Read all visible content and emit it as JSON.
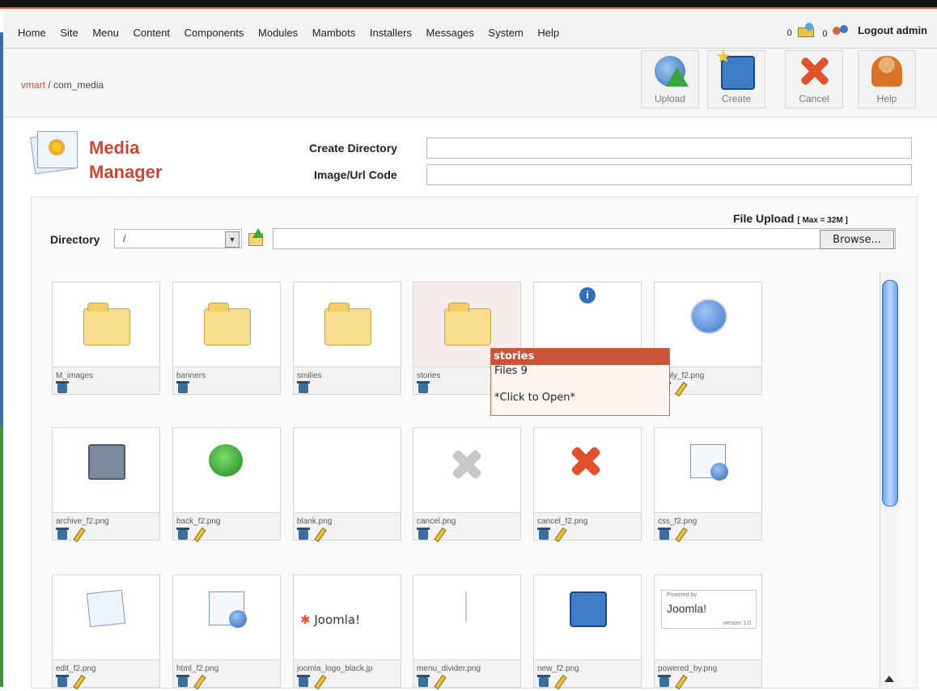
{
  "menu": {
    "items": [
      "Home",
      "Site",
      "Menu",
      "Content",
      "Components",
      "Modules",
      "Mambots",
      "Installers",
      "Messages",
      "System",
      "Help"
    ],
    "messages_count": "0",
    "users_count": "0",
    "logout_label": "Logout admin"
  },
  "breadcrumb": {
    "link": "vmart",
    "separator": " / ",
    "current": "com_media"
  },
  "toolbar": {
    "upload": "Upload",
    "create": "Create",
    "cancel": "Cancel",
    "help": "Help"
  },
  "header": {
    "title_line1": "Media",
    "title_line2": "Manager"
  },
  "form": {
    "create_directory_label": "Create Directory",
    "image_url_label": "Image/Url Code",
    "directory_label": "Directory",
    "directory_value": "/",
    "file_upload_label": "File Upload",
    "max_label": "[ Max = 32M ]",
    "browse_label": "Browse..."
  },
  "tiles": [
    {
      "name": "M_images",
      "icon": "folder-icon"
    },
    {
      "name": "banners",
      "icon": "folder-icon"
    },
    {
      "name": "smilies",
      "icon": "folder-icon"
    },
    {
      "name": "stories",
      "icon": "folder-icon"
    },
    {
      "name": "",
      "icon": "info-icon"
    },
    {
      "name": "apply_f2.png",
      "icon": "check-icon"
    },
    {
      "name": "archive_f2.png",
      "icon": "archive-icon"
    },
    {
      "name": "back_f2.png",
      "icon": "back-icon"
    },
    {
      "name": "blank.png",
      "icon": "blank"
    },
    {
      "name": "cancel.png",
      "icon": "cancel-gray-icon"
    },
    {
      "name": "cancel_f2.png",
      "icon": "cancel-red-icon"
    },
    {
      "name": "css_f2.png",
      "icon": "css-icon"
    },
    {
      "name": "edit_f2.png",
      "icon": "edit-icon"
    },
    {
      "name": "html_f2.png",
      "icon": "html-icon"
    },
    {
      "name": "joomla_logo_black.jp",
      "icon": "joomla-logo"
    },
    {
      "name": "menu_divider.png",
      "icon": "divider"
    },
    {
      "name": "new_f2.png",
      "icon": "new-icon"
    },
    {
      "name": "powered_by.png",
      "icon": "powered-by"
    }
  ],
  "tooltip": {
    "title": "stories",
    "files": "Files 9",
    "hint": "*Click to Open*"
  },
  "logo_texts": {
    "joomla": "Joomla!",
    "powered_small": "Powered by",
    "version": "version 1.0"
  },
  "colors": {
    "accent": "#c64934",
    "tooltip_header": "#c9543a",
    "scroll_thumb": "#6aa3ea"
  }
}
